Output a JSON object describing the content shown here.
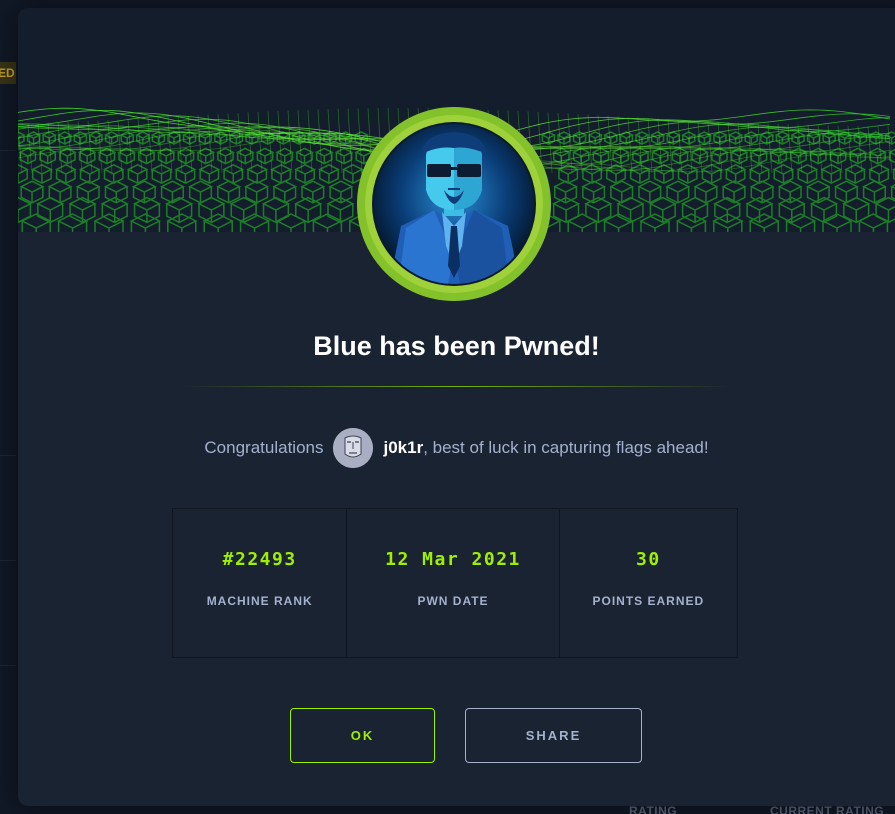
{
  "background": {
    "badge_text": "ED",
    "footer_labels": [
      "RATING",
      "CURRENT RATING"
    ]
  },
  "modal": {
    "title": "Blue has been Pwned!",
    "congrats_prefix": "Congratulations",
    "username": "j0k1r",
    "congrats_suffix": ", best of luck in capturing flags ahead!",
    "stats": [
      {
        "value": "#22493",
        "label": "MACHINE RANK"
      },
      {
        "value": "12 Mar 2021",
        "label": "PWN DATE"
      },
      {
        "value": "30",
        "label": "POINTS EARNED"
      }
    ],
    "buttons": {
      "ok": "OK",
      "share": "SHARE"
    }
  },
  "colors": {
    "accent": "#9fef00",
    "modal_bg": "#1a2332",
    "text_muted": "#a4b1cd"
  },
  "icons": [
    "hacker-avatar-icon",
    "user-avatar-icon"
  ]
}
